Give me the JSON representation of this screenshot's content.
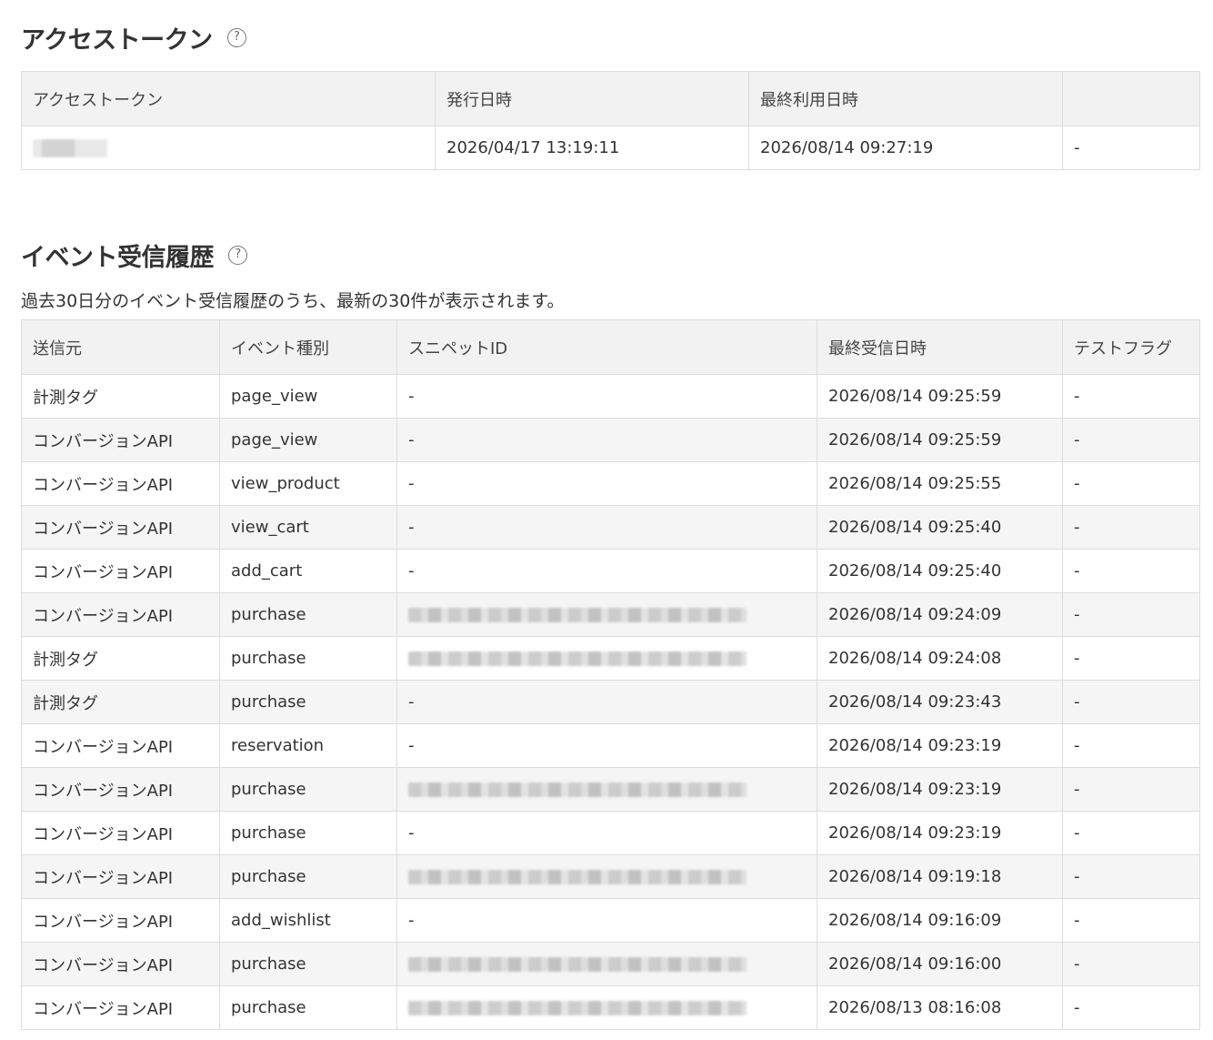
{
  "access_token_section": {
    "title": "アクセストークン",
    "help": "?",
    "headers": [
      "アクセストークン",
      "発行日時",
      "最終利用日時",
      ""
    ],
    "row": {
      "issued_at": "2026/04/17 13:19:11",
      "last_used_at": "2026/08/14 09:27:19",
      "action": "-"
    }
  },
  "events_section": {
    "title": "イベント受信履歴",
    "help": "?",
    "description": "過去30日分のイベント受信履歴のうち、最新の30件が表示されます。",
    "headers": [
      "送信元",
      "イベント種別",
      "スニペットID",
      "最終受信日時",
      "テストフラグ"
    ],
    "rows": [
      {
        "source": "計測タグ",
        "event": "page_view",
        "snippet": "-",
        "received": "2026/08/14 09:25:59",
        "test": "-"
      },
      {
        "source": "コンバージョンAPI",
        "event": "page_view",
        "snippet": "-",
        "received": "2026/08/14 09:25:59",
        "test": "-"
      },
      {
        "source": "コンバージョンAPI",
        "event": "view_product",
        "snippet": "-",
        "received": "2026/08/14 09:25:55",
        "test": "-"
      },
      {
        "source": "コンバージョンAPI",
        "event": "view_cart",
        "snippet": "-",
        "received": "2026/08/14 09:25:40",
        "test": "-"
      },
      {
        "source": "コンバージョンAPI",
        "event": "add_cart",
        "snippet": "-",
        "received": "2026/08/14 09:25:40",
        "test": "-"
      },
      {
        "source": "コンバージョンAPI",
        "event": "purchase",
        "snippet": "",
        "received": "2026/08/14 09:24:09",
        "test": "-"
      },
      {
        "source": "計測タグ",
        "event": "purchase",
        "snippet": "",
        "received": "2026/08/14 09:24:08",
        "test": "-"
      },
      {
        "source": "計測タグ",
        "event": "purchase",
        "snippet": "-",
        "received": "2026/08/14 09:23:43",
        "test": "-"
      },
      {
        "source": "コンバージョンAPI",
        "event": "reservation",
        "snippet": "-",
        "received": "2026/08/14 09:23:19",
        "test": "-"
      },
      {
        "source": "コンバージョンAPI",
        "event": "purchase",
        "snippet": "",
        "received": "2026/08/14 09:23:19",
        "test": "-"
      },
      {
        "source": "コンバージョンAPI",
        "event": "purchase",
        "snippet": "-",
        "received": "2026/08/14 09:23:19",
        "test": "-"
      },
      {
        "source": "コンバージョンAPI",
        "event": "purchase",
        "snippet": "",
        "received": "2026/08/14 09:19:18",
        "test": "-"
      },
      {
        "source": "コンバージョンAPI",
        "event": "add_wishlist",
        "snippet": "-",
        "received": "2026/08/14 09:16:09",
        "test": "-"
      },
      {
        "source": "コンバージョンAPI",
        "event": "purchase",
        "snippet": "",
        "received": "2026/08/14 09:16:00",
        "test": "-"
      },
      {
        "source": "コンバージョンAPI",
        "event": "purchase",
        "snippet": "",
        "received": "2026/08/13 08:16:08",
        "test": "-"
      }
    ]
  }
}
